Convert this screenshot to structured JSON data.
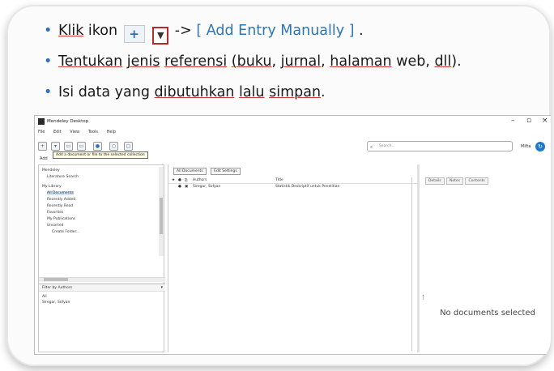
{
  "bullets": {
    "line1": {
      "pre": "Klik",
      "mid": " ikon ",
      "post": " -> ",
      "bracket": "[ Add Entry Manually ]",
      "end": " .",
      "add_icon": "add-document-icon",
      "dropdown_icon": "dropdown-arrow-icon"
    },
    "line2": {
      "w1": "Tentukan",
      "w2": "jenis",
      "w3": "referensi",
      "w4": "(buku",
      "t5": ", ",
      "w6": "jurnal",
      "t7": ", ",
      "w8": "halaman",
      "t9": " web, ",
      "w10": "dll",
      "t11": ")."
    },
    "line3": {
      "t1": "Isi data yang ",
      "w2": "dibutuhkan",
      "t3": " ",
      "w4": "lalu",
      "t5": " ",
      "w6": "simpan",
      "t7": "."
    }
  },
  "app": {
    "title": "Mendeley Desktop",
    "menu": [
      "File",
      "Edit",
      "View",
      "Tools",
      "Help"
    ],
    "window_controls": {
      "minimize": "–",
      "maximize": "▫",
      "close": "×"
    },
    "toolbar": {
      "buttons": [
        {
          "icon": "add-document-icon",
          "glyph": "+"
        },
        {
          "icon": "folder-icon",
          "glyph": "▭"
        },
        {
          "icon": "remove-folder-icon",
          "glyph": "▭"
        },
        {
          "icon": "share-icon",
          "glyph": "●"
        },
        {
          "icon": "sync-icon",
          "glyph": "○"
        },
        {
          "icon": "citation-icon",
          "glyph": "▢"
        }
      ],
      "search_placeholder": "Search...",
      "user": "Mifta"
    },
    "tooltip": "Add a document or file to the selected collection",
    "add_label": "Add",
    "left_pane": {
      "sections": [
        {
          "label": "Mendeley",
          "type": "header"
        },
        {
          "label": "Literature Search",
          "type": "item"
        },
        {
          "label": "My Library",
          "type": "header"
        },
        {
          "label": "All Documents",
          "type": "item",
          "selected": true
        },
        {
          "label": "Recently Added",
          "type": "item"
        },
        {
          "label": "Recently Read",
          "type": "item"
        },
        {
          "label": "Favorites",
          "type": "item"
        },
        {
          "label": "My Publications",
          "type": "item"
        },
        {
          "label": "Unsorted",
          "type": "item"
        },
        {
          "label": "Create Folder...",
          "type": "item"
        }
      ],
      "filter_label": "Filter by Authors",
      "filter_values": [
        "All",
        "Siregar, Sofyan"
      ]
    },
    "center_pane": {
      "tabs": [
        "All Documents",
        "Edit Settings"
      ],
      "columns": [
        "Authors",
        "Title"
      ],
      "rows": [
        {
          "author": "Siregar, Sofyan",
          "title": "Statistik Deskriptif untuk Penelitian"
        }
      ]
    },
    "right_pane": {
      "tabs": [
        "Details",
        "Notes",
        "Contents"
      ],
      "empty_message": "No documents selected"
    }
  }
}
